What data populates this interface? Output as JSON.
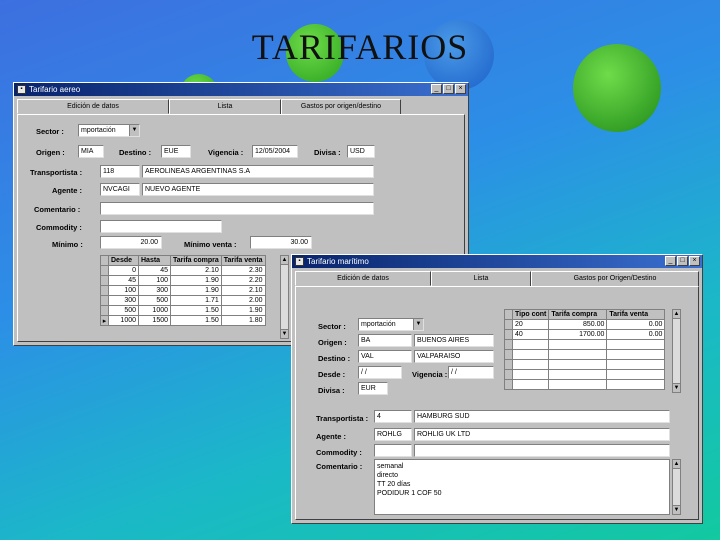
{
  "slide": {
    "title": "TARIFARIOS"
  },
  "air": {
    "title": "Tarifario aereo",
    "tabs": [
      "Edición de datos",
      "Lista",
      "Gastos por origen/destino"
    ],
    "labels": {
      "sector": "Sector :",
      "origen": "Origen :",
      "destino": "Destino :",
      "vigencia": "Vigencia :",
      "divisa": "Divisa :",
      "transportista": "Transportista :",
      "agente": "Agente :",
      "comentario": "Comentario :",
      "commodity": "Commodity :",
      "minimo": "Mínimo :",
      "minimo_venta": "Mínimo venta :"
    },
    "values": {
      "sector": "mportación",
      "origen": "MIA",
      "destino": "EUE",
      "vigencia": "12/05/2004",
      "divisa": "USD",
      "transportista_code": "118",
      "transportista_name": "AEROLINEAS ARGENTINAS S.A",
      "agente_code": "NVCAGI",
      "agente_name": "NUEVO AGENTE",
      "comentario": "",
      "commodity": "",
      "minimo": "20.00",
      "minimo_venta": "30.00"
    },
    "grid": {
      "headers": [
        "Desde",
        "Hasta",
        "Tarifa compra",
        "Tarifa venta"
      ],
      "rows": [
        [
          "0",
          "45",
          "2.10",
          "2.30"
        ],
        [
          "45",
          "100",
          "1.90",
          "2.20"
        ],
        [
          "100",
          "300",
          "1.90",
          "2.10"
        ],
        [
          "300",
          "500",
          "1.71",
          "2.00"
        ],
        [
          "500",
          "1000",
          "1.50",
          "1.90"
        ],
        [
          "1000",
          "1500",
          "1.50",
          "1.80"
        ]
      ]
    }
  },
  "sea": {
    "title": "Tarifario marítimo",
    "tabs": [
      "Edición de datos",
      "Lista",
      "Gastos por Origen/Destino"
    ],
    "labels": {
      "sector": "Sector :",
      "origen": "Origen :",
      "destino": "Destino :",
      "desde": "Desde :",
      "vigencia": "Vigencia :",
      "divisa": "Divisa :",
      "transportista": "Transportista :",
      "agente": "Agente :",
      "commodity": "Commodity :",
      "comentario": "Comentario :"
    },
    "values": {
      "sector": "mportación",
      "origen_code": "BA",
      "origen_name": "BUENOS AIRES",
      "destino_code": "VAL",
      "destino_name": "VALPARAISO",
      "desde": "/ /",
      "vigencia": "/ /",
      "divisa": "EUR",
      "transportista_code": "4",
      "transportista_name": "HAMBURG SUD",
      "agente_code": "ROHLG",
      "agente_name": "ROHLIG UK LTD",
      "commodity": ""
    },
    "comment_lines": [
      "semanal",
      "directo",
      "TT 20 días",
      "PODIDUR 1 COF 50"
    ],
    "grid": {
      "headers": [
        "Tipo cont",
        "Tarifa compra",
        "Tarifa venta"
      ],
      "rows": [
        [
          "20",
          "850.00",
          "0.00"
        ],
        [
          "40",
          "1700.00",
          "0.00"
        ]
      ]
    }
  },
  "icons": {
    "window": "window-icon",
    "minimize": "minimize-icon",
    "maximize": "maximize-icon",
    "close": "close-icon"
  },
  "colors": {
    "titlebar": "#08246b",
    "window": "#c0c0c0"
  }
}
